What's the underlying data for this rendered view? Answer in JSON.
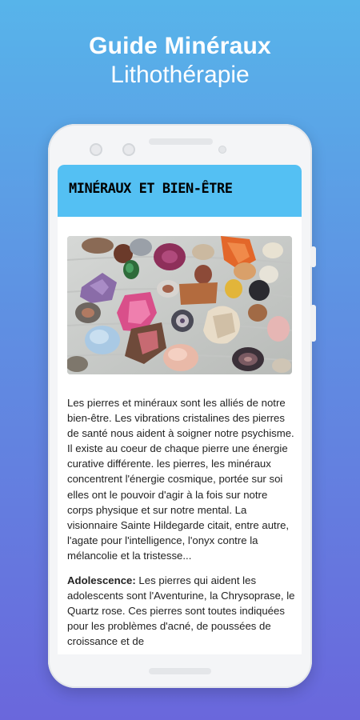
{
  "promo": {
    "title": "Guide Minéraux",
    "subtitle": "Lithothérapie"
  },
  "app_bar": {
    "title": "Minéraux et bien-être",
    "color": "#54c0f3"
  },
  "hero_image": {
    "subject": "assorted minerals and crystals"
  },
  "article": {
    "paragraph1": "Les pierres et minéraux sont les alliés de notre bien-être. Les vibrations cristalines des pierres de santé nous aident à soigner notre psychisme. Il existe au coeur de chaque pierre une énergie curative différente. les pierres, les minéraux concentrent l'énergie cosmique, portée sur soi elles ont le pouvoir d'agir à la fois sur notre corps physique et sur notre mental. La visionnaire Sainte Hildegarde citait, entre autre, l'agate pour l'intelligence, l'onyx contre la mélancolie et la tristesse...",
    "section_label": "Adolescence:",
    "section_text": " Les pierres qui aident les adolescents sont l'Aventurine, la Chrysoprase, le Quartz rose. Ces pierres sont toutes indiquées pour les problèmes d'acné, de poussées de croissance et de"
  },
  "colors": {
    "background_top": "#57b4ea",
    "background_bottom": "#6a67dc",
    "accent": "#54c0f3"
  }
}
